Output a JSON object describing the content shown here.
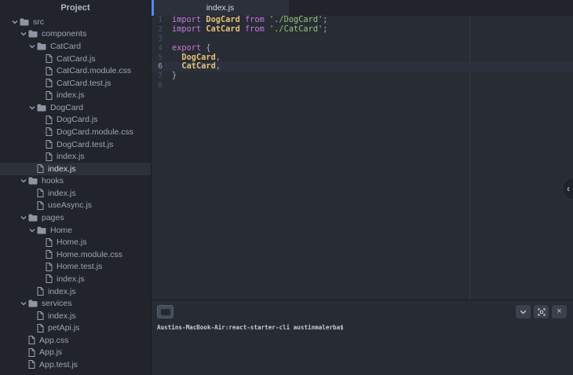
{
  "colors": {
    "accent": "#568af2",
    "keyword": "#c678dd",
    "identifier": "#e5c07b",
    "string": "#98c379",
    "code_fg": "#abb2bf",
    "sidebar_bg": "#21252b",
    "editor_bg": "#282c34",
    "selection_bg": "#2c313a",
    "cursor_line_bg": "#2c323d",
    "gutter_fg": "#4b5263",
    "tree_fg": "#9da5b4",
    "terminal_fg": "#c9cdd4"
  },
  "sidebar": {
    "header": "Project",
    "tree": [
      {
        "label": "src",
        "type": "folder",
        "level": 0,
        "expanded": true
      },
      {
        "label": "components",
        "type": "folder",
        "level": 1,
        "expanded": true
      },
      {
        "label": "CatCard",
        "type": "folder",
        "level": 2,
        "expanded": true
      },
      {
        "label": "CatCard.js",
        "type": "file",
        "level": 3
      },
      {
        "label": "CatCard.module.css",
        "type": "file",
        "level": 3
      },
      {
        "label": "CatCard.test.js",
        "type": "file",
        "level": 3
      },
      {
        "label": "index.js",
        "type": "file",
        "level": 3
      },
      {
        "label": "DogCard",
        "type": "folder",
        "level": 2,
        "expanded": true
      },
      {
        "label": "DogCard.js",
        "type": "file",
        "level": 3
      },
      {
        "label": "DogCard.module.css",
        "type": "file",
        "level": 3
      },
      {
        "label": "DogCard.test.js",
        "type": "file",
        "level": 3
      },
      {
        "label": "index.js",
        "type": "file",
        "level": 3
      },
      {
        "label": "index.js",
        "type": "file",
        "level": 2,
        "selected": true
      },
      {
        "label": "hooks",
        "type": "folder",
        "level": 1,
        "expanded": true
      },
      {
        "label": "index.js",
        "type": "file",
        "level": 2
      },
      {
        "label": "useAsync.js",
        "type": "file",
        "level": 2
      },
      {
        "label": "pages",
        "type": "folder",
        "level": 1,
        "expanded": true
      },
      {
        "label": "Home",
        "type": "folder",
        "level": 2,
        "expanded": true
      },
      {
        "label": "Home.js",
        "type": "file",
        "level": 3
      },
      {
        "label": "Home.module.css",
        "type": "file",
        "level": 3
      },
      {
        "label": "Home.test.js",
        "type": "file",
        "level": 3
      },
      {
        "label": "index.js",
        "type": "file",
        "level": 3
      },
      {
        "label": "index.js",
        "type": "file",
        "level": 2
      },
      {
        "label": "services",
        "type": "folder",
        "level": 1,
        "expanded": true
      },
      {
        "label": "index.js",
        "type": "file",
        "level": 2
      },
      {
        "label": "petApi.js",
        "type": "file",
        "level": 2
      },
      {
        "label": "App.css",
        "type": "file",
        "level": 1
      },
      {
        "label": "App.js",
        "type": "file",
        "level": 1
      },
      {
        "label": "App.test.js",
        "type": "file",
        "level": 1
      }
    ]
  },
  "editor": {
    "tab_label": "index.js",
    "lines": [
      {
        "num": 1,
        "tokens": [
          {
            "c": "keyword",
            "t": "import"
          },
          {
            "c": "plain",
            "t": " "
          },
          {
            "c": "identifier",
            "t": "DogCard"
          },
          {
            "c": "plain",
            "t": " "
          },
          {
            "c": "keyword",
            "t": "from"
          },
          {
            "c": "plain",
            "t": " "
          },
          {
            "c": "string",
            "t": "'./DogCard'"
          },
          {
            "c": "plain",
            "t": ";"
          }
        ]
      },
      {
        "num": 2,
        "tokens": [
          {
            "c": "keyword",
            "t": "import"
          },
          {
            "c": "plain",
            "t": " "
          },
          {
            "c": "identifier",
            "t": "CatCard"
          },
          {
            "c": "plain",
            "t": " "
          },
          {
            "c": "keyword",
            "t": "from"
          },
          {
            "c": "plain",
            "t": " "
          },
          {
            "c": "string",
            "t": "'./CatCard'"
          },
          {
            "c": "plain",
            "t": ";"
          }
        ]
      },
      {
        "num": 3,
        "tokens": []
      },
      {
        "num": 4,
        "tokens": [
          {
            "c": "keyword",
            "t": "export"
          },
          {
            "c": "plain",
            "t": " {"
          }
        ]
      },
      {
        "num": 5,
        "tokens": [
          {
            "c": "plain",
            "t": "  "
          },
          {
            "c": "identifier",
            "t": "DogCard"
          },
          {
            "c": "plain",
            "t": ","
          }
        ]
      },
      {
        "num": 6,
        "cursor_line": true,
        "tokens": [
          {
            "c": "plain",
            "t": "  "
          },
          {
            "c": "identifier",
            "t": "CatCard"
          },
          {
            "c": "plain",
            "t": ","
          }
        ]
      },
      {
        "num": 7,
        "tokens": [
          {
            "c": "plain",
            "t": "}"
          }
        ]
      },
      {
        "num": 8,
        "tokens": []
      }
    ]
  },
  "terminal": {
    "prompt": "Austins-MacBook-Air:react-starter-cli austinmalerba$",
    "toolbar": {
      "tab_icon": "terminal-icon",
      "actions": [
        {
          "icon": "chevron-down-icon"
        },
        {
          "icon": "maximize-icon"
        },
        {
          "icon": "close-icon",
          "glyph": "×"
        }
      ]
    }
  },
  "dock_toggle": {
    "icon": "chevron-left-icon",
    "glyph": "‹"
  }
}
